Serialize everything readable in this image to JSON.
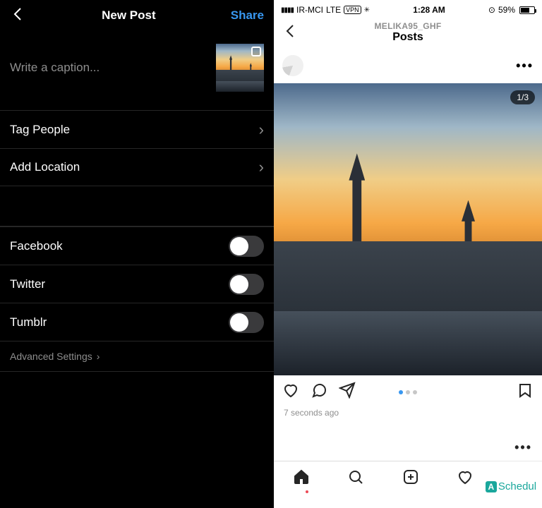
{
  "left": {
    "header": {
      "title": "New Post",
      "share": "Share"
    },
    "caption_placeholder": "Write a caption...",
    "rows": {
      "tag_people": "Tag People",
      "add_location": "Add Location"
    },
    "share_targets": [
      {
        "label": "Facebook",
        "on": false
      },
      {
        "label": "Twitter",
        "on": false
      },
      {
        "label": "Tumblr",
        "on": false
      }
    ],
    "advanced": "Advanced Settings"
  },
  "right": {
    "status": {
      "signal": "▮▮▮▮",
      "carrier": "IR-MCI",
      "network": "LTE",
      "vpn": "VPN",
      "time": "1:28 AM",
      "alarm_icon": "alarm",
      "battery_pct": "59%"
    },
    "header": {
      "username": "MELIKA95_GHF",
      "section": "Posts"
    },
    "counter": "1/3",
    "timestamp": "7 seconds ago",
    "watermark": "Schedul"
  }
}
